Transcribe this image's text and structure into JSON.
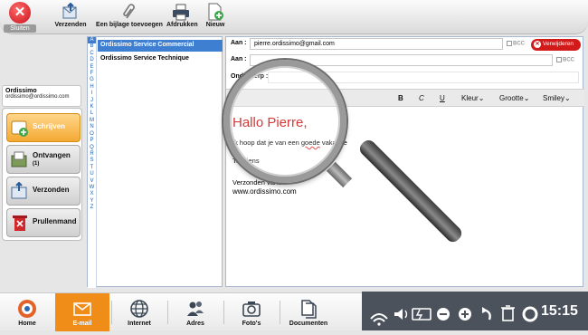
{
  "toolbar": {
    "close_label": "Sluiten",
    "items": [
      {
        "label": "Verzenden",
        "icon": "send-icon"
      },
      {
        "label": "Een bijlage toevoegen",
        "icon": "paperclip-icon"
      },
      {
        "label": "Afdrukken",
        "icon": "printer-icon"
      },
      {
        "label": "Nieuw",
        "icon": "new-document-icon"
      }
    ]
  },
  "account": {
    "name": "Ordissimo",
    "email": "ordissimo@ordissimo.com"
  },
  "folders": [
    {
      "label": "Schrijven",
      "icon": "write-icon",
      "active": true
    },
    {
      "label": "Ontvangen",
      "count": "(1)",
      "icon": "inbox-icon"
    },
    {
      "label": "Verzonden",
      "icon": "sent-icon"
    },
    {
      "label": "Prullenmand",
      "icon": "trash-icon"
    }
  ],
  "alphabet": [
    "A",
    "B",
    "C",
    "D",
    "E",
    "F",
    "G",
    "H",
    "I",
    "J",
    "K",
    "L",
    "M",
    "N",
    "O",
    "P",
    "Q",
    "R",
    "S",
    "T",
    "U",
    "V",
    "W",
    "X",
    "Y",
    "Z"
  ],
  "contacts": [
    {
      "name": "Ordissimo Service Commercial",
      "selected": true
    },
    {
      "name": "Ordissimo Service Technique",
      "selected": false
    }
  ],
  "compose": {
    "to_label": "Aan :",
    "to_value": "pierre.ordissimo@gmail.com",
    "cc_label": "Aan :",
    "bcc_label": "BCC",
    "remove_label": "Verwijderen",
    "subject_label": "Onderwerp :",
    "format": {
      "bold": "B",
      "italic": "C",
      "underline": "U",
      "color": "Kleur",
      "size": "Grootte",
      "smiley": "Smiley"
    },
    "body": {
      "greeting": "Hallo Pierre,",
      "line1_a": "Ik hoop dat je van een ",
      "line1_b": "goede",
      "line1_c": " vakantie",
      "line2": "Tot ziens",
      "line3": "Verzonden vanuit",
      "line4": "www.ordissimo.com"
    }
  },
  "bottom_nav": [
    {
      "label": "Home",
      "icon": "home-icon"
    },
    {
      "label": "E-mail",
      "icon": "mail-icon",
      "active": true
    },
    {
      "label": "Internet",
      "icon": "globe-icon"
    },
    {
      "label": "Adres",
      "icon": "contacts-icon"
    },
    {
      "label": "Foto's",
      "icon": "camera-icon"
    },
    {
      "label": "Documenten",
      "icon": "documents-icon"
    }
  ],
  "tray": {
    "clock": "15:15"
  },
  "colors": {
    "accent": "#f08c18",
    "selection": "#3f7fd2",
    "danger": "#d31a1a",
    "tray": "#4b525c"
  }
}
